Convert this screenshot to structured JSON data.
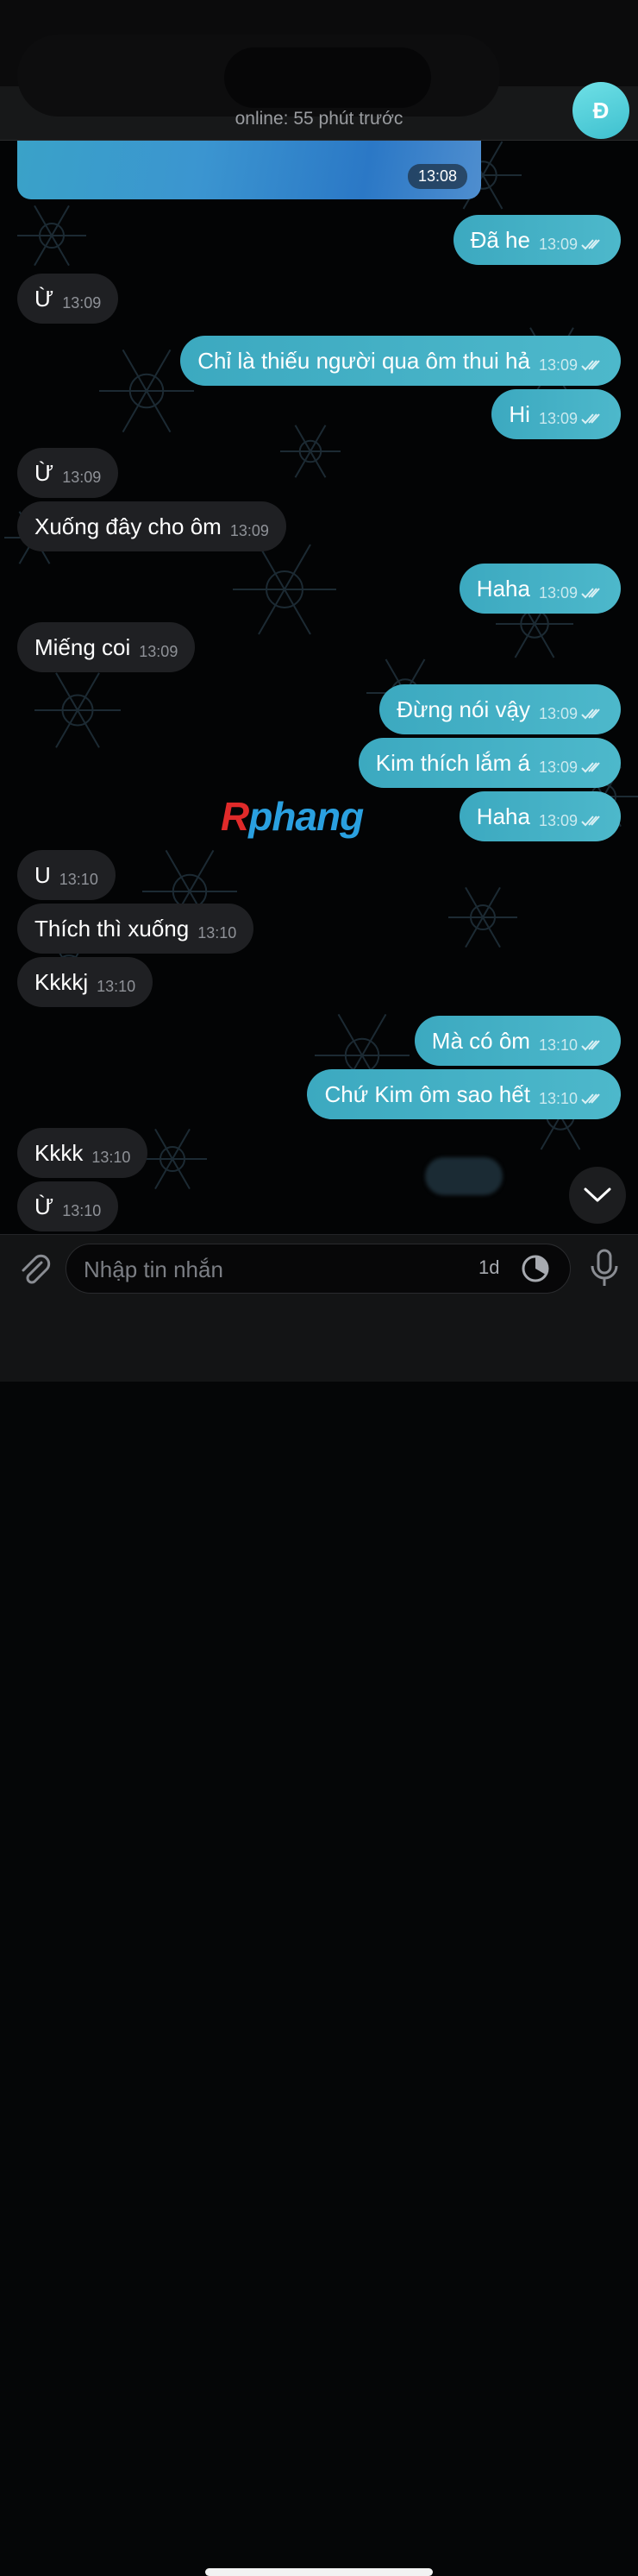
{
  "header": {
    "status": "online: 55 phút trước",
    "avatar_letter": "Đ"
  },
  "media": {
    "time": "13:08"
  },
  "messages": [
    {
      "dir": "out",
      "text": "Đã he",
      "time": "13:09"
    },
    {
      "dir": "in",
      "text": "Ừ",
      "time": "13:09"
    },
    {
      "dir": "out",
      "text": "Chỉ là thiếu người qua ôm thui hả",
      "time": "13:09"
    },
    {
      "dir": "out",
      "text": "Hi",
      "time": "13:09"
    },
    {
      "dir": "in",
      "text": "Ừ",
      "time": "13:09"
    },
    {
      "dir": "in",
      "text": "Xuống đây cho ôm",
      "time": "13:09"
    },
    {
      "dir": "out",
      "text": "Haha",
      "time": "13:09"
    },
    {
      "dir": "in",
      "text": "Miếng coi",
      "time": "13:09"
    },
    {
      "dir": "out",
      "text": "Đừng nói vậy",
      "time": "13:09"
    },
    {
      "dir": "out",
      "text": "Kim thích lắm á",
      "time": "13:09"
    },
    {
      "dir": "out",
      "text": "Haha",
      "time": "13:09"
    },
    {
      "dir": "in",
      "text": "U",
      "time": "13:10"
    },
    {
      "dir": "in",
      "text": "Thích thì xuống",
      "time": "13:10"
    },
    {
      "dir": "in",
      "text": "Kkkkj",
      "time": "13:10"
    },
    {
      "dir": "out",
      "text": "Mà có           ôm",
      "time": "13:10"
    },
    {
      "dir": "out",
      "text": "Chứ Kim ôm sao hết",
      "time": "13:10"
    },
    {
      "dir": "in",
      "text": "Kkkk",
      "time": "13:10"
    },
    {
      "dir": "in",
      "text": "Ừ",
      "time": "13:10"
    }
  ],
  "watermark": {
    "r": "R",
    "rest": "phang"
  },
  "composer": {
    "placeholder": "Nhập tin nhắn",
    "timer_label": "1d"
  },
  "icons": {
    "attach": "paperclip-icon",
    "timer": "self-destruct-timer-icon",
    "mic": "microphone-icon",
    "scroll": "chevron-down-icon",
    "read": "double-check-icon"
  },
  "colors": {
    "outgoing_bubble": "#45b1c6",
    "incoming_bubble": "#1f2023",
    "avatar": "#4ec9d6"
  }
}
